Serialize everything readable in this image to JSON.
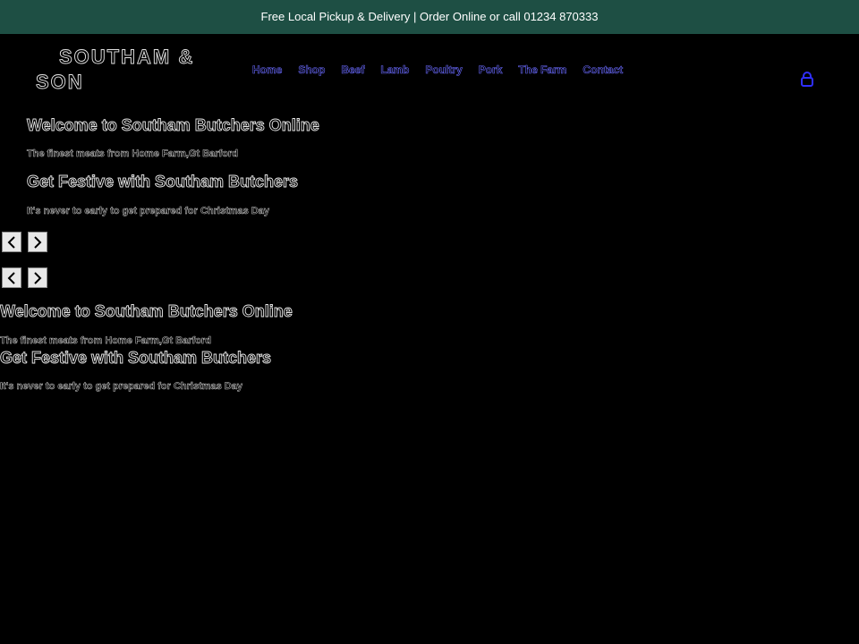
{
  "announcement": {
    "text": "Free Local Pickup & Delivery | Order Online or call 01234 870333"
  },
  "logo": {
    "line1": "SOUTHAM &",
    "line2": "SON"
  },
  "nav": {
    "items": [
      "Home",
      "Shop",
      "Beef",
      "Lamb",
      "Poultry",
      "Pork",
      "The Farm",
      "Contact"
    ]
  },
  "cart": {
    "icon": "shopping-bag-icon",
    "color": "#2f2fff"
  },
  "slider_primary": {
    "slides": [
      {
        "title": "Welcome to Southam Butchers Online",
        "subtitle": "The finest meats from Home Farm,Gt Barford"
      },
      {
        "title": "Get Festive with Southam Butchers",
        "subtitle": "It's never to early to get prepared for Christmas Day"
      }
    ]
  },
  "slider_secondary": {
    "slides": [
      {
        "title": "Welcome to Southam Butchers Online",
        "subtitle": "The finest meats from Home Farm,Gt Barford"
      },
      {
        "title": "Get Festive with Southam Butchers",
        "subtitle": "It's never to early to get prepared for Christmas Day"
      }
    ]
  },
  "colors": {
    "announcement_bg": "#1e4f44",
    "page_bg": "#000000",
    "nav_link": "#6a6aff"
  }
}
